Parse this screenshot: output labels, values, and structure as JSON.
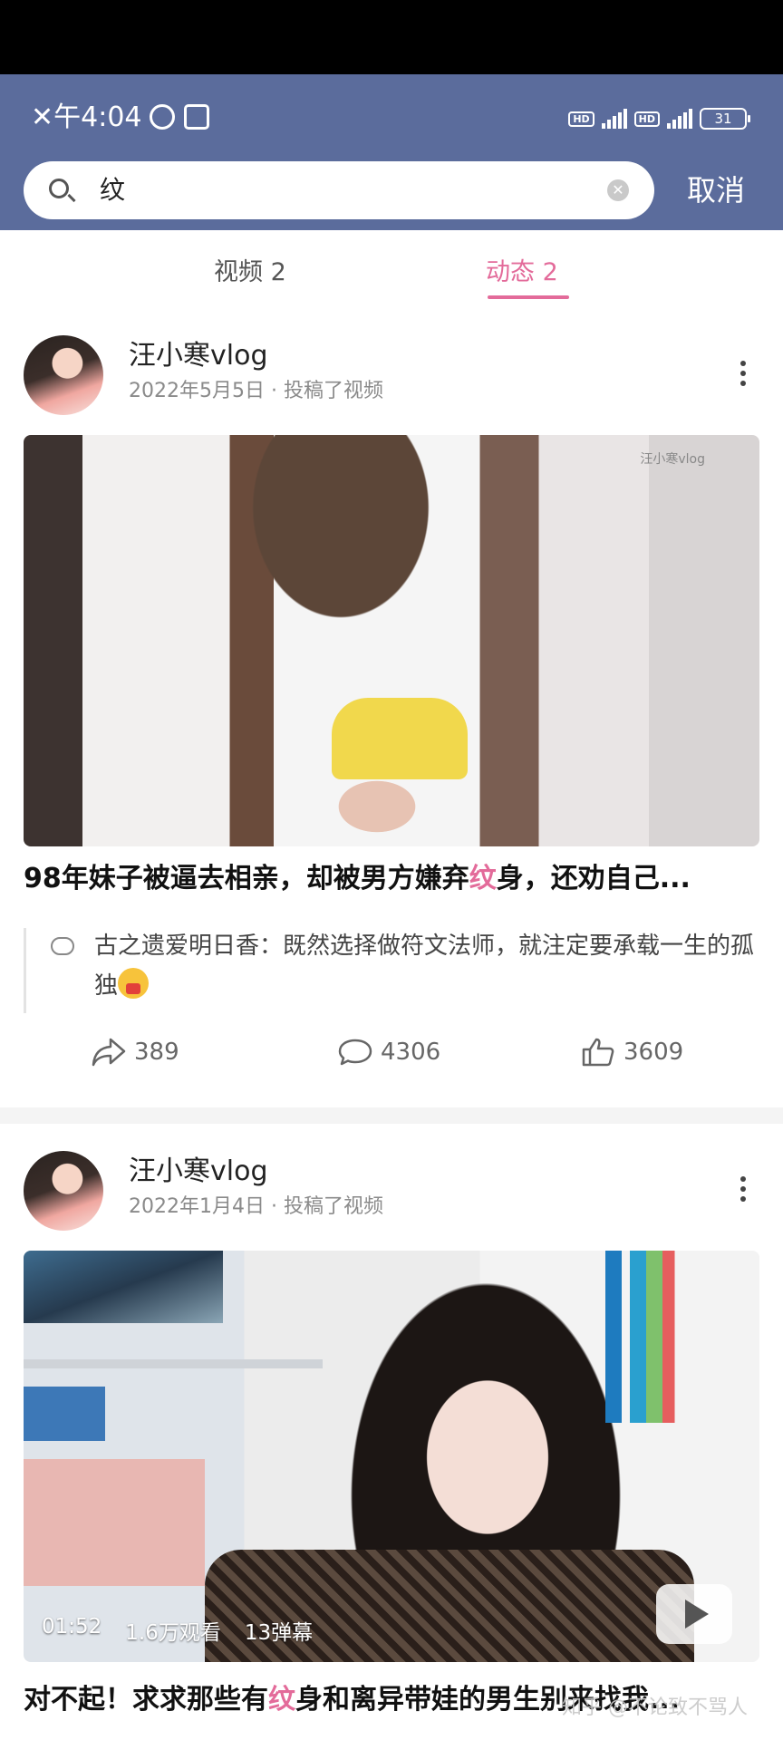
{
  "status_bar": {
    "time": "午4:04",
    "battery": "31"
  },
  "search": {
    "query": "纹",
    "cancel_label": "取消"
  },
  "tabs": [
    {
      "label": "视频 2"
    },
    {
      "label": "动态 2"
    }
  ],
  "posts": [
    {
      "author": "汪小寒vlog",
      "date": "2022年5月5日",
      "action": "投稿了视频",
      "title_before": "98年妹子被逼去相亲，却被男方嫌弃",
      "title_highlight": "纹",
      "title_after": "身，还劝自己...",
      "comment": "古之遗爱明日香：既然选择做符文法师，就注定要承载一生的孤独",
      "shares": "389",
      "comments": "4306",
      "likes": "3609"
    },
    {
      "author": "汪小寒vlog",
      "date": "2022年1月4日",
      "action": "投稿了视频",
      "duration": "01:52",
      "views": "1.6万观看",
      "danmaku": "13弹幕",
      "title_before": "对不起！求求那些有",
      "title_highlight": "纹",
      "title_after": "身和离异带娃的男生别来找我..."
    }
  ],
  "colors": {
    "header": "#5b6c9c",
    "accent": "#e36b9a"
  },
  "watermark": "知乎 @不论致不骂人"
}
